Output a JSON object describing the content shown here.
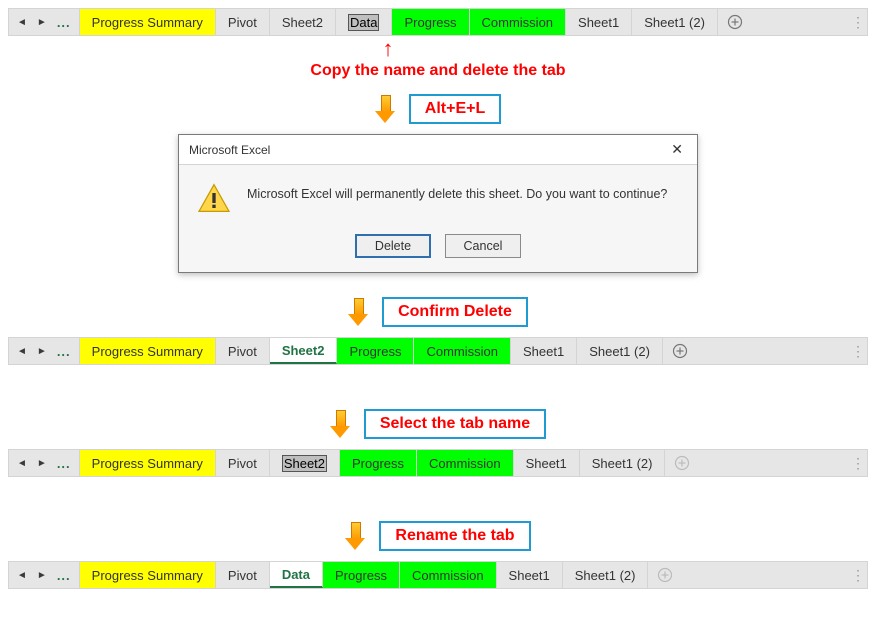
{
  "tabbars": {
    "bar1": {
      "tabs": [
        {
          "label": "Progress Summary",
          "cls": "yellow first"
        },
        {
          "label": "Pivot",
          "cls": ""
        },
        {
          "label": "Sheet2",
          "cls": ""
        },
        {
          "label": "Data",
          "cls": "rename-sel"
        },
        {
          "label": "Progress",
          "cls": "green"
        },
        {
          "label": "Commission",
          "cls": "green"
        },
        {
          "label": "Sheet1",
          "cls": ""
        },
        {
          "label": "Sheet1 (2)",
          "cls": ""
        }
      ]
    },
    "bar2": {
      "tabs": [
        {
          "label": "Progress Summary",
          "cls": "yellow first"
        },
        {
          "label": "Pivot",
          "cls": ""
        },
        {
          "label": "Sheet2",
          "cls": "active"
        },
        {
          "label": "Progress",
          "cls": "green"
        },
        {
          "label": "Commission",
          "cls": "green"
        },
        {
          "label": "Sheet1",
          "cls": ""
        },
        {
          "label": "Sheet1 (2)",
          "cls": ""
        }
      ]
    },
    "bar3": {
      "tabs": [
        {
          "label": "Progress Summary",
          "cls": "yellow first"
        },
        {
          "label": "Pivot",
          "cls": ""
        },
        {
          "label": "Sheet2",
          "cls": "rename-sel"
        },
        {
          "label": "Progress",
          "cls": "green"
        },
        {
          "label": "Commission",
          "cls": "green"
        },
        {
          "label": "Sheet1",
          "cls": ""
        },
        {
          "label": "Sheet1 (2)",
          "cls": ""
        }
      ]
    },
    "bar4": {
      "tabs": [
        {
          "label": "Progress Summary",
          "cls": "yellow first"
        },
        {
          "label": "Pivot",
          "cls": ""
        },
        {
          "label": "Data",
          "cls": "rename-done"
        },
        {
          "label": "Progress",
          "cls": "green"
        },
        {
          "label": "Commission",
          "cls": "green"
        },
        {
          "label": "Sheet1",
          "cls": ""
        },
        {
          "label": "Sheet1 (2)",
          "cls": ""
        }
      ]
    }
  },
  "arrow_up": "↑",
  "caption1": "Copy the name and delete the tab",
  "steps": {
    "s1": "Alt+E+L",
    "s2": "Confirm Delete",
    "s3": "Select the tab name",
    "s4": "Rename the tab"
  },
  "dialog": {
    "title": "Microsoft Excel",
    "message": "Microsoft Excel will permanently delete this sheet. Do you want to continue?",
    "delete": "Delete",
    "cancel": "Cancel"
  },
  "nav": {
    "dots": "..."
  },
  "plus": "⊕"
}
